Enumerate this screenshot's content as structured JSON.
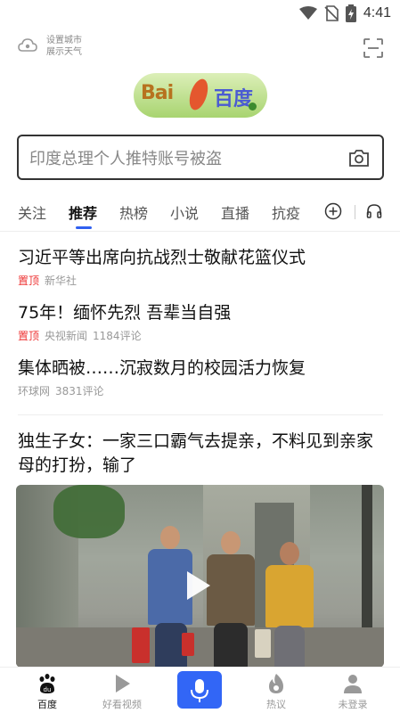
{
  "status_bar": {
    "time": "4:41",
    "icons": [
      "wifi-icon",
      "no-sim-icon",
      "battery-charging-icon"
    ]
  },
  "header": {
    "weather_line1": "设置城市",
    "weather_line2": "展示天气",
    "weather_icon": "cloud-location-icon",
    "scan_icon": "scan-icon"
  },
  "logo": {
    "left_text": "Bai",
    "right_text": "百度"
  },
  "search": {
    "placeholder": "印度总理个人推特账号被盗",
    "camera_icon": "camera-icon"
  },
  "tabs": [
    {
      "label": "关注",
      "active": false
    },
    {
      "label": "推荐",
      "active": true
    },
    {
      "label": "热榜",
      "active": false
    },
    {
      "label": "小说",
      "active": false
    },
    {
      "label": "直播",
      "active": false
    },
    {
      "label": "抗疫",
      "active": false
    }
  ],
  "news": [
    {
      "title": "习近平等出席向抗战烈士敬献花篮仪式",
      "tag": "置顶",
      "source": "新华社",
      "comments": ""
    },
    {
      "title": "75年！缅怀先烈 吾辈当自强",
      "tag": "置顶",
      "source": "央视新闻",
      "comments": "1184评论"
    },
    {
      "title": "集体晒被……沉寂数月的校园活力恢复",
      "tag": "",
      "source": "环球网",
      "comments": "3831评论"
    }
  ],
  "feature": {
    "title": "独生子女：一家三口霸气去提亲，不料见到亲家母的打扮，输了"
  },
  "bottom_nav": [
    {
      "label": "百度",
      "icon": "baidu-paw-icon",
      "active": true
    },
    {
      "label": "好看视频",
      "icon": "video-play-icon",
      "active": false
    },
    {
      "label": "",
      "icon": "microphone-icon",
      "active": false
    },
    {
      "label": "热议",
      "icon": "fire-icon",
      "active": false
    },
    {
      "label": "未登录",
      "icon": "user-icon",
      "active": false
    }
  ],
  "colors": {
    "accent": "#3266f6",
    "top_tag": "#e33333",
    "meta": "#999999"
  }
}
